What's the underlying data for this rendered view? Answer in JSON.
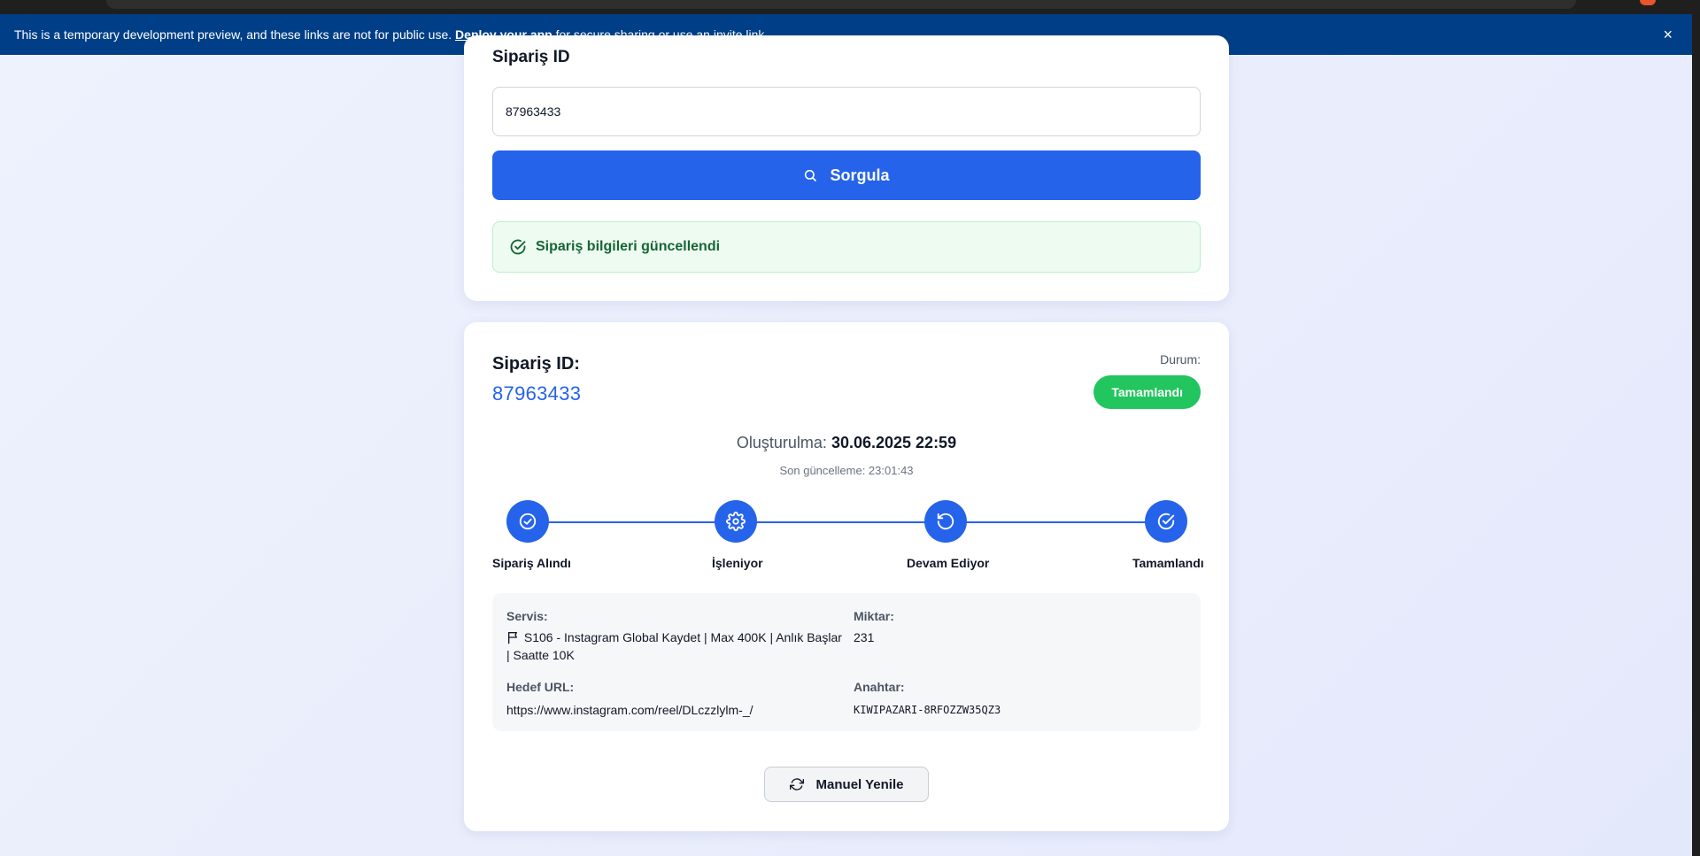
{
  "banner": {
    "text_before": "This is a temporary development preview, and these links are not for public use.",
    "link_label": "Deploy your app",
    "text_after": "for secure sharing or use an invite link.",
    "close_icon": "×"
  },
  "query_card": {
    "field_label": "Sipariş ID",
    "input_value": "87963433",
    "button_label": "Sorgula",
    "alert_text": "Sipariş bilgileri güncellendi"
  },
  "order": {
    "title": "Sipariş ID:",
    "id": "87963433",
    "status_label": "Durum:",
    "status_value": "Tamamlandı",
    "created_label": "Oluşturulma:",
    "created_value": "30.06.2025 22:59",
    "updated_text": "Son güncelleme: 23:01:43",
    "steps": [
      {
        "label": "Sipariş Alındı",
        "icon": "check-circle-icon"
      },
      {
        "label": "İşleniyor",
        "icon": "gear-icon"
      },
      {
        "label": "Devam Ediyor",
        "icon": "rotate-icon"
      },
      {
        "label": "Tamamlandı",
        "icon": "check-circle-icon"
      }
    ],
    "details": {
      "service_label": "Servis:",
      "service_line1": "S106 - Instagram Global Kaydet | Max 400K | Anlık Başlar",
      "service_line2": "| Saatte 10K",
      "quantity_label": "Miktar:",
      "quantity_value": "231",
      "url_label": "Hedef URL:",
      "url_value": "https://www.instagram.com/reel/DLczzlylm-_/",
      "key_label": "Anahtar:",
      "key_value": "KIWIPAZARI-8RFOZZW35QZ3"
    },
    "refresh_label": "Manuel Yenile"
  },
  "colors": {
    "banner": "#003f87",
    "primary": "#2563eb",
    "success": "#22c55e",
    "alert_bg": "#edfbf1"
  }
}
